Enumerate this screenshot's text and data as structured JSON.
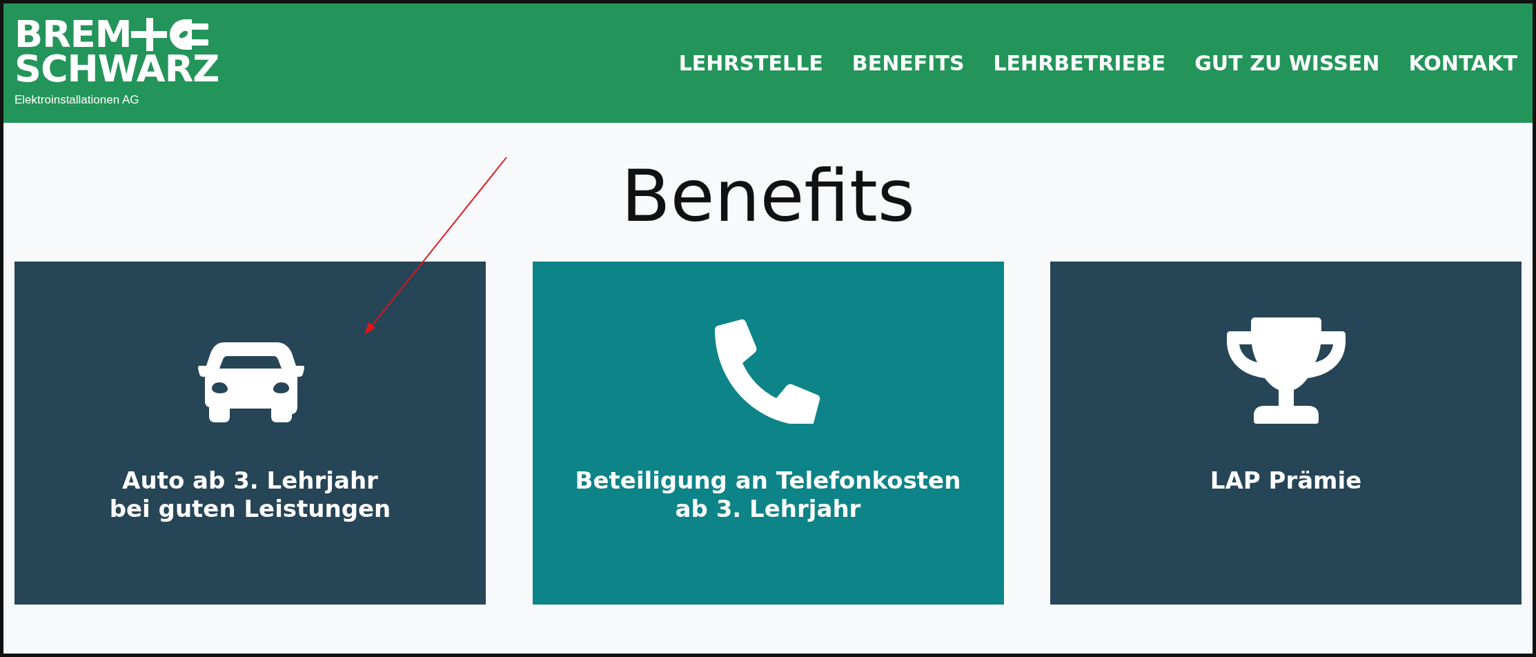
{
  "logo": {
    "line_1": "BREM",
    "line_2": "SCHWARZ",
    "tagline": "Elektroinstallationen AG"
  },
  "nav": [
    "LEHRSTELLE",
    "BENEFITS",
    "LEHRBETRIEBE",
    "GUT ZU WISSEN",
    "KONTAKT"
  ],
  "heading": "Benefits",
  "cards": [
    {
      "lines": [
        "Auto ab 3. Lehrjahr",
        "bei guten Leistungen"
      ],
      "color": "#264557"
    },
    {
      "lines": [
        "Beteiligung an Telefonkosten",
        "ab 3. Lehrjahr"
      ],
      "color": "#0d8488"
    },
    {
      "lines": [
        "LAP Prämie"
      ],
      "color": "#264557"
    }
  ]
}
